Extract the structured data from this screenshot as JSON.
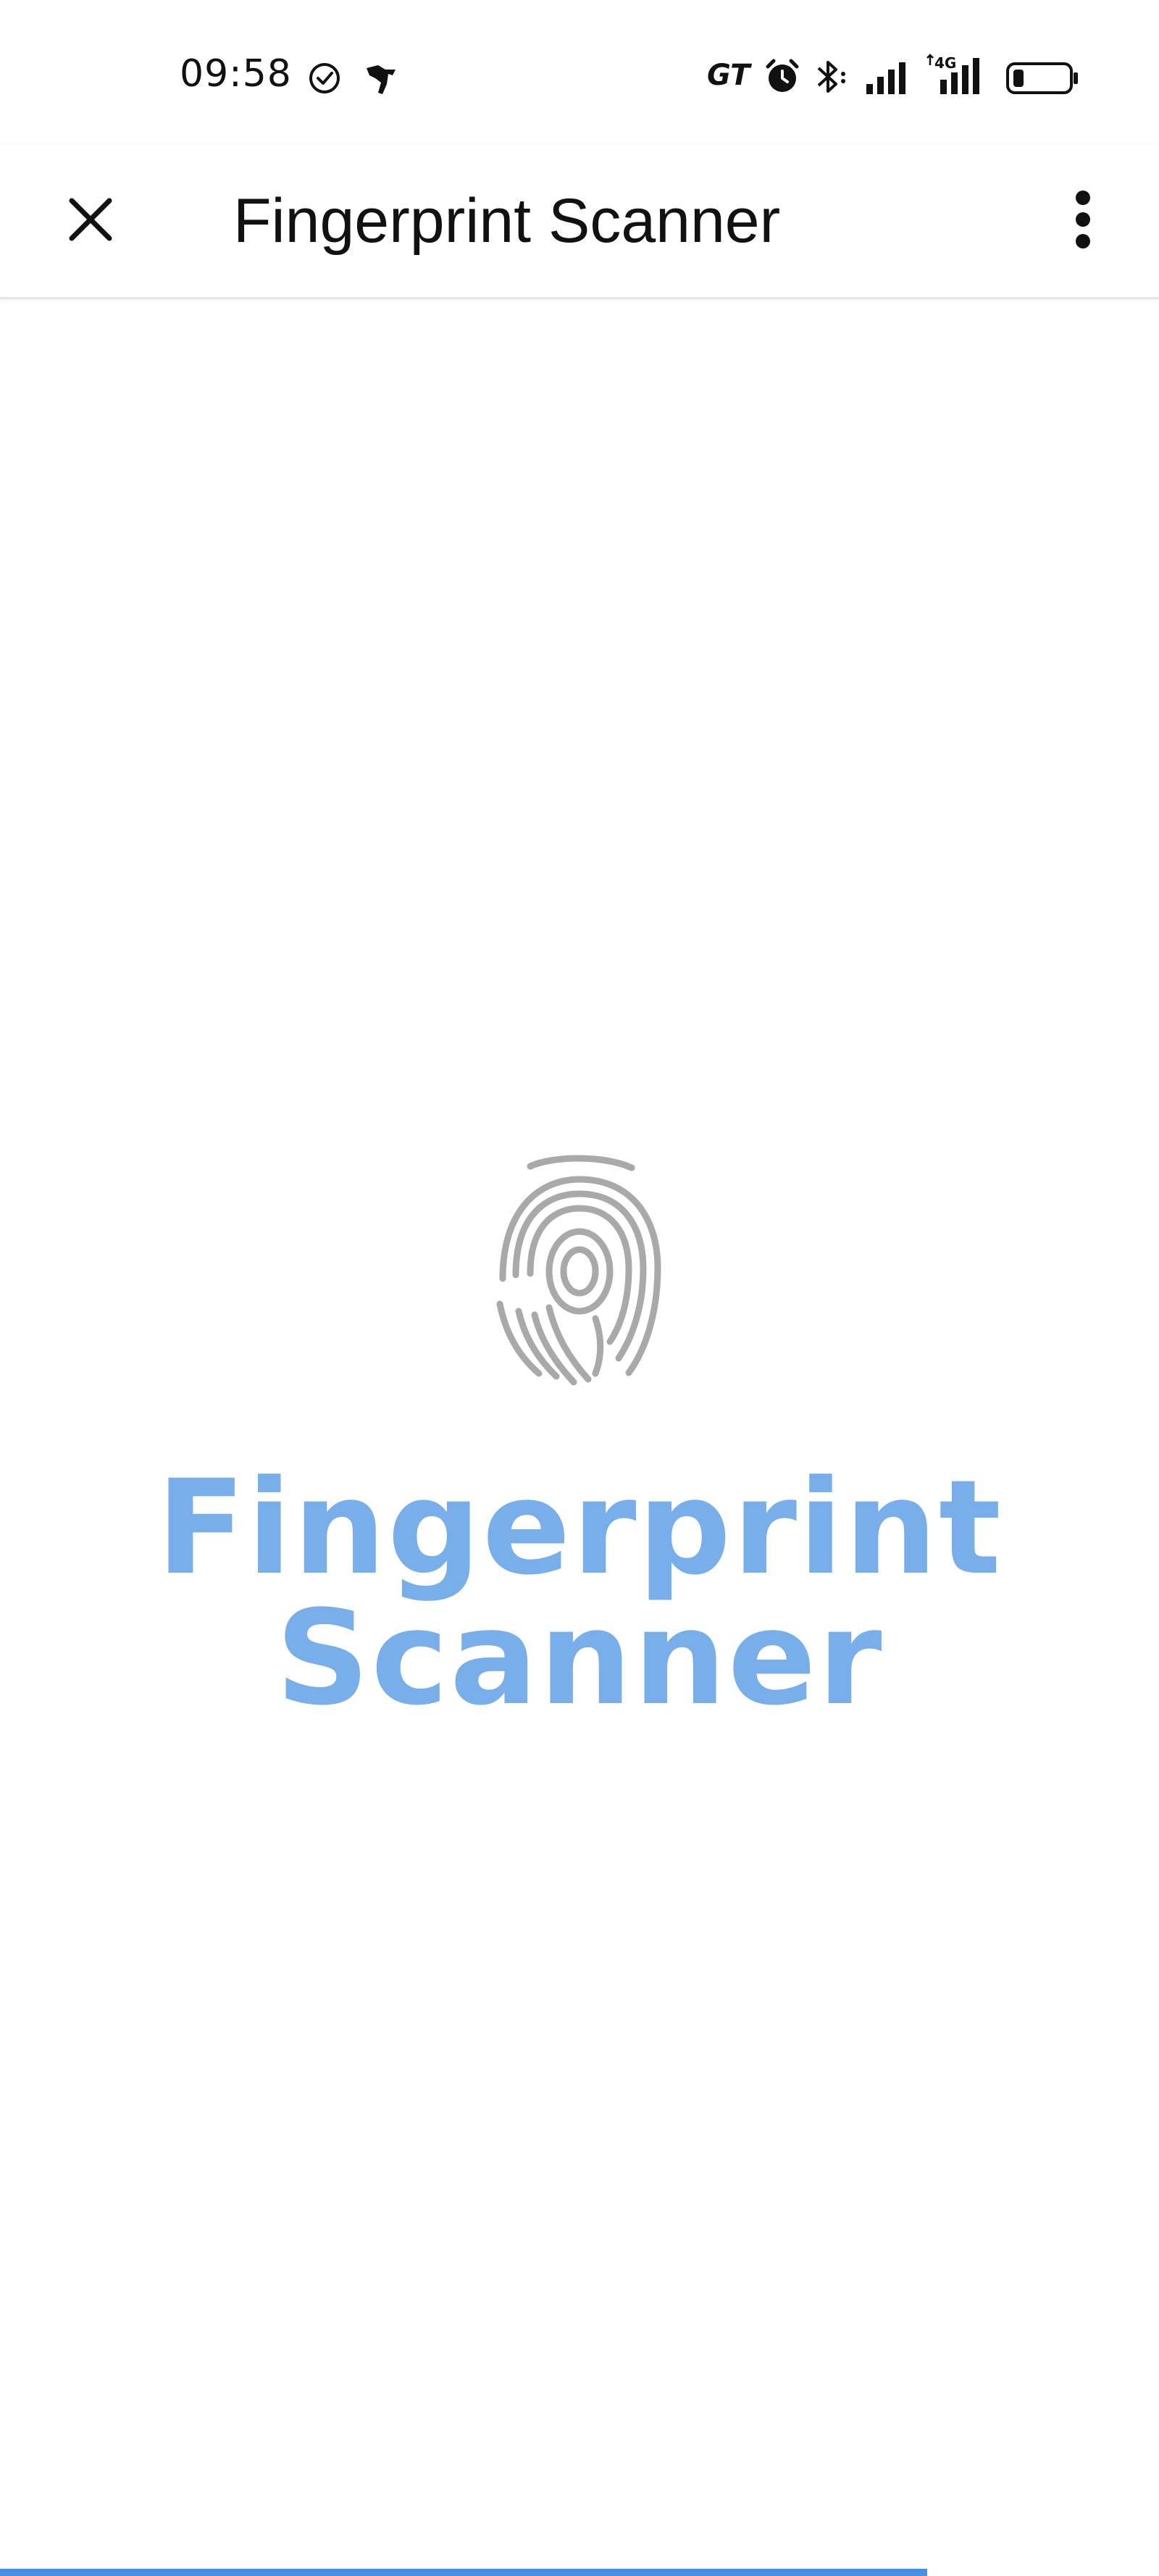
{
  "status_bar": {
    "time": "09:58",
    "carrier_badge": "GT",
    "network_label": "4G",
    "icons": [
      "check-circle-icon",
      "notification-runner-icon",
      "alarm-icon",
      "bluetooth-icon",
      "signal-icon",
      "signal-4g-icon",
      "battery-icon"
    ],
    "battery_level": 0.2
  },
  "app_bar": {
    "title": "Fingerprint Scanner",
    "close_icon": "close-icon",
    "menu_icon": "more-vert-icon"
  },
  "splash": {
    "logo_icon": "fingerprint-icon",
    "title_line1": "Fingerprint",
    "title_line2": "Scanner",
    "title_color": "#78aee9"
  },
  "loading": {
    "progress": 0.8,
    "color": "#4a90e2"
  }
}
